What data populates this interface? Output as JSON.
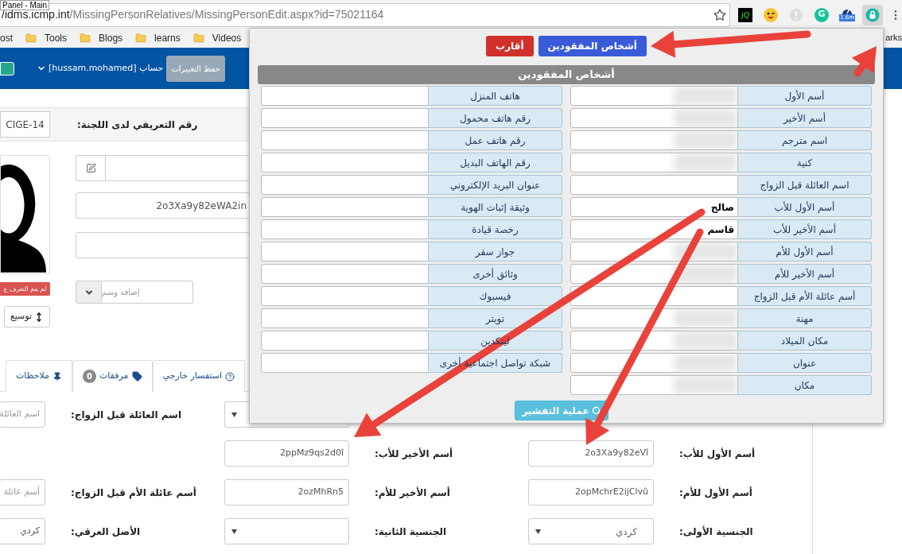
{
  "browser": {
    "tooltip": "Panel - Main",
    "url": {
      "host": "/idms.icmp.int",
      "path": "/MissingPersonRelatives/MissingPersonEdit.aspx?id=75021164"
    },
    "extensions": [
      {
        "kind": "lock",
        "pressed": true
      },
      {
        "kind": "gauge",
        "badge": "1.6m",
        "pressed": false
      },
      {
        "kind": "grammarly",
        "label": "G",
        "pressed": false
      },
      {
        "kind": "blocked",
        "pressed": false
      },
      {
        "kind": "emoji",
        "pressed": false
      },
      {
        "kind": "jq",
        "label": "jQ",
        "pressed": false
      }
    ],
    "bookmarks": [
      {
        "kind": "folder",
        "label": "Videos"
      },
      {
        "kind": "folder",
        "label": "learns"
      },
      {
        "kind": "folder",
        "label": "Blogs"
      },
      {
        "kind": "folder",
        "label": "Tools"
      },
      {
        "kind": "plain",
        "label": "ost"
      }
    ],
    "other_bookmarks": "arks"
  },
  "header": {
    "account": "[hussam.mohamed] حساب",
    "save_button": "حفظ التغييرات"
  },
  "id_row": {
    "label": "رقم التعريفي لدى اللجنة:",
    "value": "CIGE-14"
  },
  "profile": {
    "badge": "لم يتم التعرف ع",
    "expand_button": "توسيع",
    "fields": [
      {
        "kind": "edit"
      },
      {
        "kind": "text",
        "value": "2o3Xa9y82eWA2in"
      },
      {
        "kind": "text"
      },
      {
        "kind": "tag",
        "placeholder": "إضافة وسم"
      }
    ]
  },
  "tabs": [
    {
      "label": "استفسار خارجي",
      "kind": "question"
    },
    {
      "label": "مرفقات",
      "kind": "tag",
      "count": "0"
    },
    {
      "label": "ملاحظات",
      "kind": "pin"
    }
  ],
  "form": {
    "rows": [
      {
        "cells": [
          {
            "kind": "none"
          },
          {
            "kind": "none"
          },
          {
            "kind": "none"
          },
          {
            "kind": "select"
          },
          {
            "kind": "label",
            "text": "اسم العائلة قبل الزواج:"
          },
          {
            "kind": "field",
            "placeholder": "اسم العائلة"
          }
        ]
      },
      {
        "cells": [
          {
            "kind": "label",
            "text": "أسم الأول للأب:"
          },
          {
            "kind": "field",
            "value": "2o3Xa9y82eVî"
          },
          {
            "kind": "label",
            "text": "أسم الأخير للأب:"
          },
          {
            "kind": "field",
            "value": "2ppMz9qs2d0î"
          },
          {
            "kind": "none"
          },
          {
            "kind": "none"
          }
        ]
      },
      {
        "cells": [
          {
            "kind": "label",
            "text": "أسم الأول للأم:"
          },
          {
            "kind": "field",
            "value": "2opMchrE2ijClvû"
          },
          {
            "kind": "label",
            "text": "أسم الأخير للأم:"
          },
          {
            "kind": "field",
            "value": "2ozMhRn5"
          },
          {
            "kind": "label",
            "text": "أسم عائلة الأم قبل الزواج:"
          },
          {
            "kind": "field",
            "placeholder": "أسم عائلة"
          }
        ]
      },
      {
        "cells": [
          {
            "kind": "label",
            "text": "الجنسية الأولى:"
          },
          {
            "kind": "select",
            "value": "كردي"
          },
          {
            "kind": "label",
            "text": "الجنسية الثانية:"
          },
          {
            "kind": "select"
          },
          {
            "kind": "label",
            "text": "الأصل العرقي:"
          },
          {
            "kind": "field",
            "value": "كردي"
          }
        ]
      }
    ]
  },
  "popup": {
    "tabs": [
      {
        "label": "أشخاص المفقودين",
        "selected": true
      },
      {
        "label": "أقارب",
        "selected": false
      }
    ],
    "title": "أشخاص المفقودين",
    "right_column": [
      {
        "label": "أسم الأول",
        "redacted": true
      },
      {
        "label": "أسم الأخير",
        "redacted": true
      },
      {
        "label": "اسم مترجم",
        "redacted": true
      },
      {
        "label": "كنية",
        "redacted": true
      },
      {
        "label": "اسم العائلة قبل الزواج",
        "redacted": false
      },
      {
        "label": "أسم الأول للأب",
        "value": "صالح",
        "redacted": false
      },
      {
        "label": "أسم الأخير للأب",
        "value": "قاسم",
        "redacted": false
      },
      {
        "label": "أسم الأول للأم",
        "redacted": true
      },
      {
        "label": "أسم الأخير للأم",
        "redacted": true
      },
      {
        "label": "أسم عائلة الأم قبل الزواج",
        "redacted": false
      },
      {
        "label": "مهنة",
        "redacted": true
      },
      {
        "label": "مكان الميلاد",
        "redacted": true
      },
      {
        "label": "عنوان",
        "redacted": true
      },
      {
        "label": "مكان",
        "redacted": true
      }
    ],
    "left_column": [
      {
        "label": "هاتف المنزل"
      },
      {
        "label": "رقم هاتف محمول"
      },
      {
        "label": "رقم هاتف عمل"
      },
      {
        "label": "رقم الهاتف البديل"
      },
      {
        "label": "عنوان البريد الإلكتروني"
      },
      {
        "label": "وثيقة إثبات الهوية"
      },
      {
        "label": "رخصة قيادة"
      },
      {
        "label": "جواز سفر"
      },
      {
        "label": "وثائق أخرى"
      },
      {
        "label": "فيسبوك"
      },
      {
        "label": "تويتر"
      },
      {
        "label": "لينكدين"
      },
      {
        "label": "شبكة تواصل اجتماعية أخرى"
      }
    ],
    "search_button": "عملية التفشير"
  }
}
